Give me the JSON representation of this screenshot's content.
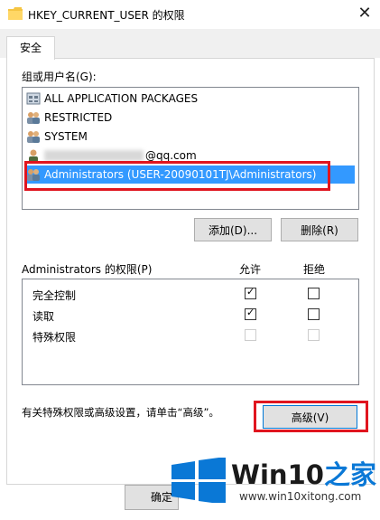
{
  "window": {
    "title": "HKEY_CURRENT_USER 的权限",
    "close_glyph": "✕"
  },
  "tabs": [
    {
      "label": "安全"
    }
  ],
  "group_users": {
    "label": "组或用户名(G):",
    "items": [
      {
        "text": "ALL APPLICATION PACKAGES",
        "icon": "app-packages-icon"
      },
      {
        "text": "RESTRICTED",
        "icon": "users-group-icon"
      },
      {
        "text": "SYSTEM",
        "icon": "users-group-icon"
      },
      {
        "text": "@qq.com",
        "icon": "user-icon"
      },
      {
        "text": "Administrators (USER-20090101TJ\\Administrators)",
        "icon": "users-group-icon",
        "selected": true
      }
    ]
  },
  "buttons": {
    "add": "添加(D)...",
    "remove": "删除(R)",
    "advanced": "高级(V)",
    "ok_partial": "确定"
  },
  "permissions": {
    "header": "Administrators 的权限(P)",
    "allow": "允许",
    "deny": "拒绝",
    "rows": [
      {
        "name": "完全控制",
        "allow": true,
        "deny": false,
        "disabled": false
      },
      {
        "name": "读取",
        "allow": true,
        "deny": false,
        "disabled": false
      },
      {
        "name": "特殊权限",
        "allow": false,
        "deny": false,
        "disabled": true
      }
    ]
  },
  "advanced_hint": "有关特殊权限或高级设置，请单击“高级”。",
  "watermark": {
    "brand": "Win10",
    "suffix": "之家",
    "url": "www.win10xitong.com"
  },
  "colors": {
    "selection": "#3399ff",
    "highlight_box": "#e0151f",
    "brand_blue": "#0a78d6"
  }
}
